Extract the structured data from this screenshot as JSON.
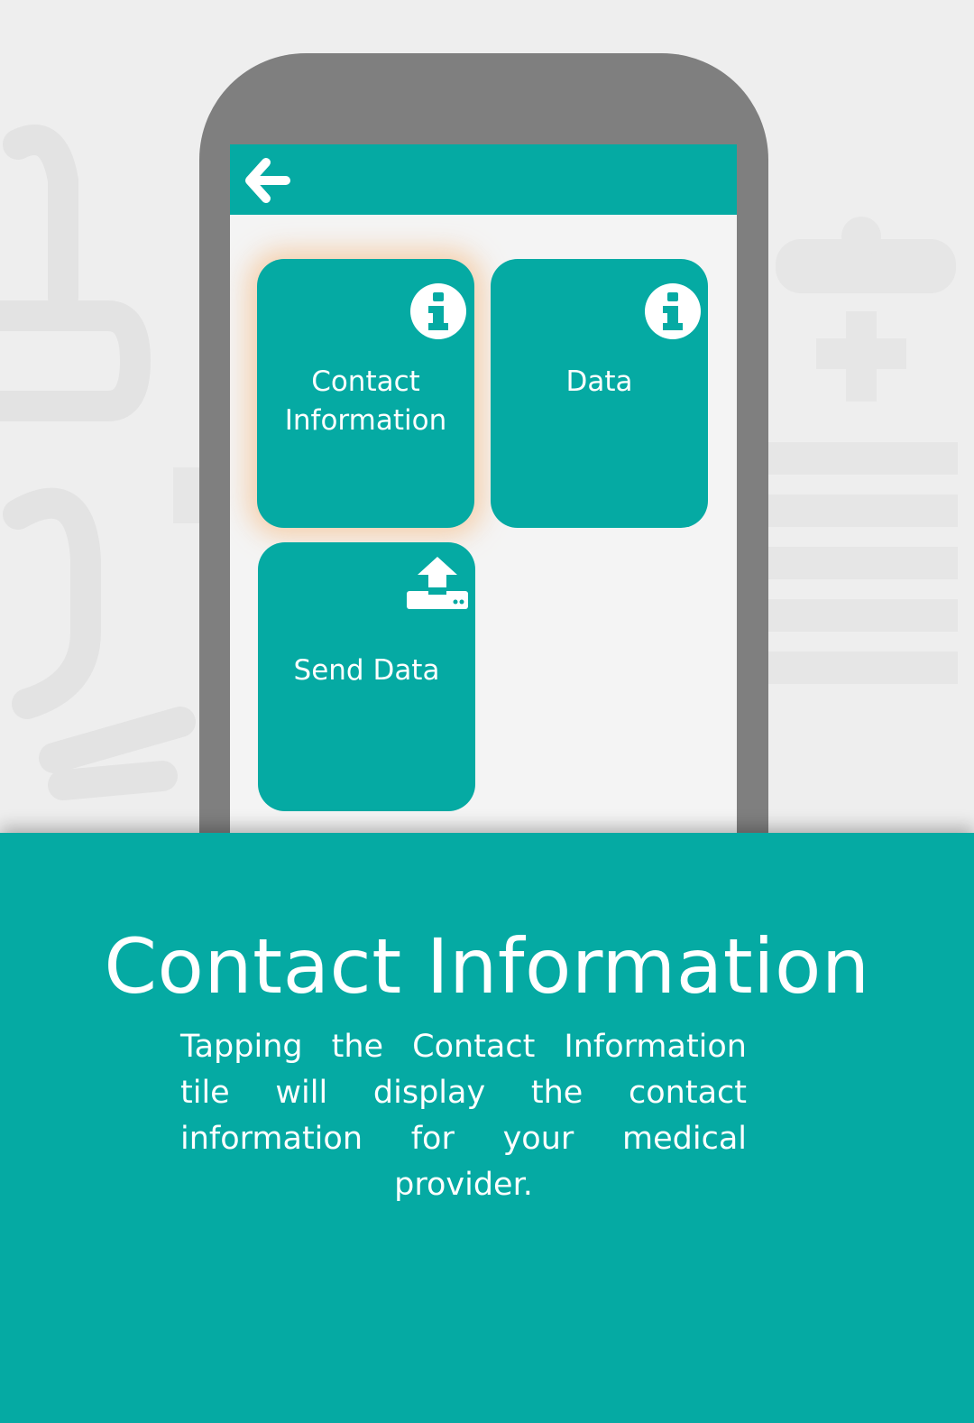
{
  "app": {
    "back_icon": "arrow-left-icon"
  },
  "tiles": [
    {
      "label": "Contact\nInformation",
      "icon": "info-icon",
      "highlighted": true
    },
    {
      "label": "Data",
      "icon": "info-icon",
      "highlighted": false
    },
    {
      "label": "Send Data",
      "icon": "upload-icon",
      "highlighted": false
    }
  ],
  "panel": {
    "title": "Contact Information",
    "description": "Tapping the Contact Information tile will display the contact information for your medical provider."
  },
  "colors": {
    "accent": "#05aaa3",
    "phone_frame": "#7f7f7f",
    "screen_bg": "#f4f4f4",
    "page_bg": "#eeeeee",
    "highlight_glow": "#f6c496"
  }
}
